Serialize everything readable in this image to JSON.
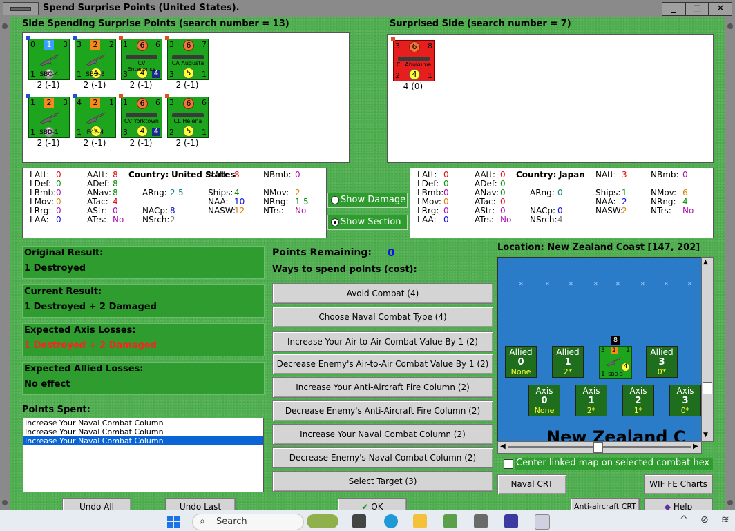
{
  "window": {
    "title": "Spend Surprise Points (United States).",
    "min_label": "_",
    "max_label": "□",
    "close_label": "✕"
  },
  "spending": {
    "header": "Side Spending Surprise Points (search number = 13)",
    "units": [
      {
        "name": "SBC-4",
        "tl": "0",
        "top": "1",
        "tr": "3",
        "bl": "1",
        "mid": "2",
        "caption": "2 (-1)"
      },
      {
        "name": "SBD-3",
        "tl": "3",
        "top": "2",
        "tr": "2",
        "bl": "1",
        "mid": "4",
        "caption": "2 (-1)"
      },
      {
        "name": "CV Enterprise",
        "tl": "1",
        "top": "6",
        "tr": "6",
        "bl": "3",
        "mid": "4",
        "sq": "4",
        "caption": "2 (-1)"
      },
      {
        "name": "CA Augusta",
        "tl": "3",
        "top": "6",
        "tr": "7",
        "bl": "3",
        "mid": "5",
        "br": "1",
        "caption": "2 (-1)"
      },
      {
        "name": "SBD-1",
        "tl": "1",
        "top": "2",
        "tr": "3",
        "bl": "1",
        "mid": "2",
        "caption": "2 (-1)"
      },
      {
        "name": "F4F-4",
        "tl": "4",
        "top": "2",
        "tr": "1",
        "bl": "1",
        "mid": "5",
        "caption": "2 (-1)"
      },
      {
        "name": "CV Yorktown",
        "tl": "1",
        "top": "6",
        "tr": "6",
        "bl": "3",
        "mid": "4",
        "sq": "4",
        "caption": "2 (-1)"
      },
      {
        "name": "CL Helena",
        "tl": "3",
        "top": "6",
        "tr": "6",
        "bl": "2",
        "mid": "5",
        "br": "1",
        "caption": "2 (-1)"
      }
    ]
  },
  "surprised": {
    "header": "Surprised Side (search number = 7)",
    "units": [
      {
        "name": "CL Abukuma",
        "tl": "3",
        "top": "6",
        "tr": "8",
        "bl": "2",
        "mid": "4",
        "br": "1",
        "caption": "4 (0)"
      }
    ]
  },
  "stats_us": {
    "country_label": "Country:",
    "country": "United States",
    "rows": [
      {
        "l1": "LAtt:",
        "v1": "0",
        "l2": "AAtt:",
        "v2": "8",
        "l4": "NAtt:",
        "v4": "8",
        "l5": "NBmb:",
        "v5": "0"
      },
      {
        "l1": "LDef:",
        "v1": "0",
        "l2": "ADef:",
        "v2": "8",
        "l4": "",
        "v4": "",
        "l5": "",
        "v5": ""
      },
      {
        "l1": "LBmb:",
        "v1": "0",
        "l2": "ANav:",
        "v2": "8",
        "l3": "ARng:",
        "v3": "2-5",
        "l4": "Ships:",
        "v4": "4",
        "l5": "NMov:",
        "v5": "2"
      },
      {
        "l1": "LMov:",
        "v1": "0",
        "l2": "ATac:",
        "v2": "4",
        "l4": "NAA:",
        "v4": "10",
        "l5": "NRng:",
        "v5": "1-5"
      },
      {
        "l1": "LRrg:",
        "v1": "0",
        "l2": "AStr:",
        "v2": "0",
        "l3": "NACp:",
        "v3": "8",
        "l4": "NASW:",
        "v4": "12",
        "l5": "NTrs:",
        "v5": "No"
      },
      {
        "l1": "LAA:",
        "v1": "0",
        "l2": "ATrs:",
        "v2": "No",
        "l3": "NSrch:",
        "v3": "2"
      }
    ]
  },
  "stats_jp": {
    "country_label": "Country:",
    "country": "Japan",
    "rows": [
      {
        "l1": "LAtt:",
        "v1": "0",
        "l2": "AAtt:",
        "v2": "0",
        "l4": "NAtt:",
        "v4": "3",
        "l5": "NBmb:",
        "v5": "0"
      },
      {
        "l1": "LDef:",
        "v1": "0",
        "l2": "ADef:",
        "v2": "0"
      },
      {
        "l1": "LBmb:",
        "v1": "0",
        "l2": "ANav:",
        "v2": "0",
        "l3": "ARng:",
        "v3": "0",
        "l4": "Ships:",
        "v4": "1",
        "l5": "NMov:",
        "v5": "6"
      },
      {
        "l1": "LMov:",
        "v1": "0",
        "l2": "ATac:",
        "v2": "0",
        "l4": "NAA:",
        "v4": "2",
        "l5": "NRng:",
        "v5": "4"
      },
      {
        "l1": "LRrg:",
        "v1": "0",
        "l2": "AStr:",
        "v2": "0",
        "l3": "NACp:",
        "v3": "0",
        "l4": "NASW:",
        "v4": "2",
        "l5": "NTrs:",
        "v5": "No"
      },
      {
        "l1": "LAA:",
        "v1": "0",
        "l2": "ATrs:",
        "v2": "No",
        "l3": "NSrch:",
        "v3": "4"
      }
    ]
  },
  "options": {
    "show_damage": "Show Damage",
    "show_section": "Show Section"
  },
  "results": {
    "original_label": "Original Result:",
    "original": "1 Destroyed",
    "current_label": "Current Result:",
    "current": "1 Destroyed + 2 Damaged",
    "axis_label": "Expected Axis Losses:",
    "axis": "1 Destroyed + 2 Damaged",
    "allied_label": "Expected Allied Losses:",
    "allied": "No effect",
    "spent_label": "Points Spent:",
    "spent": [
      "Increase Your Naval Combat Column",
      "Increase Your Naval Combat Column",
      "Increase Your Naval Combat Column"
    ]
  },
  "points": {
    "label": "Points Remaining:",
    "value": "0",
    "ways_label": "Ways to spend points (cost):"
  },
  "actions": [
    "Avoid Combat (4)",
    "Choose Naval Combat Type (4)",
    "Increase Your Air-to-Air Combat Value By 1 (2)",
    "Decrease Enemy's Air-to-Air Combat Value By 1 (2)",
    "Increase Your Anti-Aircraft Fire Column (2)",
    "Decrease Enemy's Anti-Aircraft Fire Column (2)",
    "Increase Your Naval Combat Column (2)",
    "Decrease Enemy's Naval Combat Column (2)",
    "Select Target (3)"
  ],
  "map": {
    "location": "Location: New Zealand Coast [147, 202]",
    "label": "New Zealand C",
    "allied": [
      {
        "a": "Allied",
        "b": "0",
        "c": "None"
      },
      {
        "a": "Allied",
        "b": "1",
        "c": "2*"
      },
      {
        "a": "Allied",
        "b": "3",
        "c": "0*"
      }
    ],
    "axis": [
      {
        "a": "Axis",
        "b": "0",
        "c": "None"
      },
      {
        "a": "Axis",
        "b": "1",
        "c": "2*"
      },
      {
        "a": "Axis",
        "b": "2",
        "c": "1*"
      },
      {
        "a": "Axis",
        "b": "3",
        "c": "0*"
      }
    ],
    "unit": {
      "stack": "8",
      "tl": "3",
      "top": "2",
      "tr": "2",
      "mid": "4",
      "bl": "1",
      "name": "SBD-3"
    },
    "center_check": "Center linked map on selected combat hex"
  },
  "buttons": {
    "naval_crt": "Naval CRT",
    "wif_charts": "WIF FE Charts",
    "undo_all": "Undo All",
    "undo_last": "Undo Last",
    "ok": "OK",
    "aa_crt": "Anti-aircraft CRT",
    "help": "Help"
  },
  "taskbar": {
    "search": "Search"
  }
}
